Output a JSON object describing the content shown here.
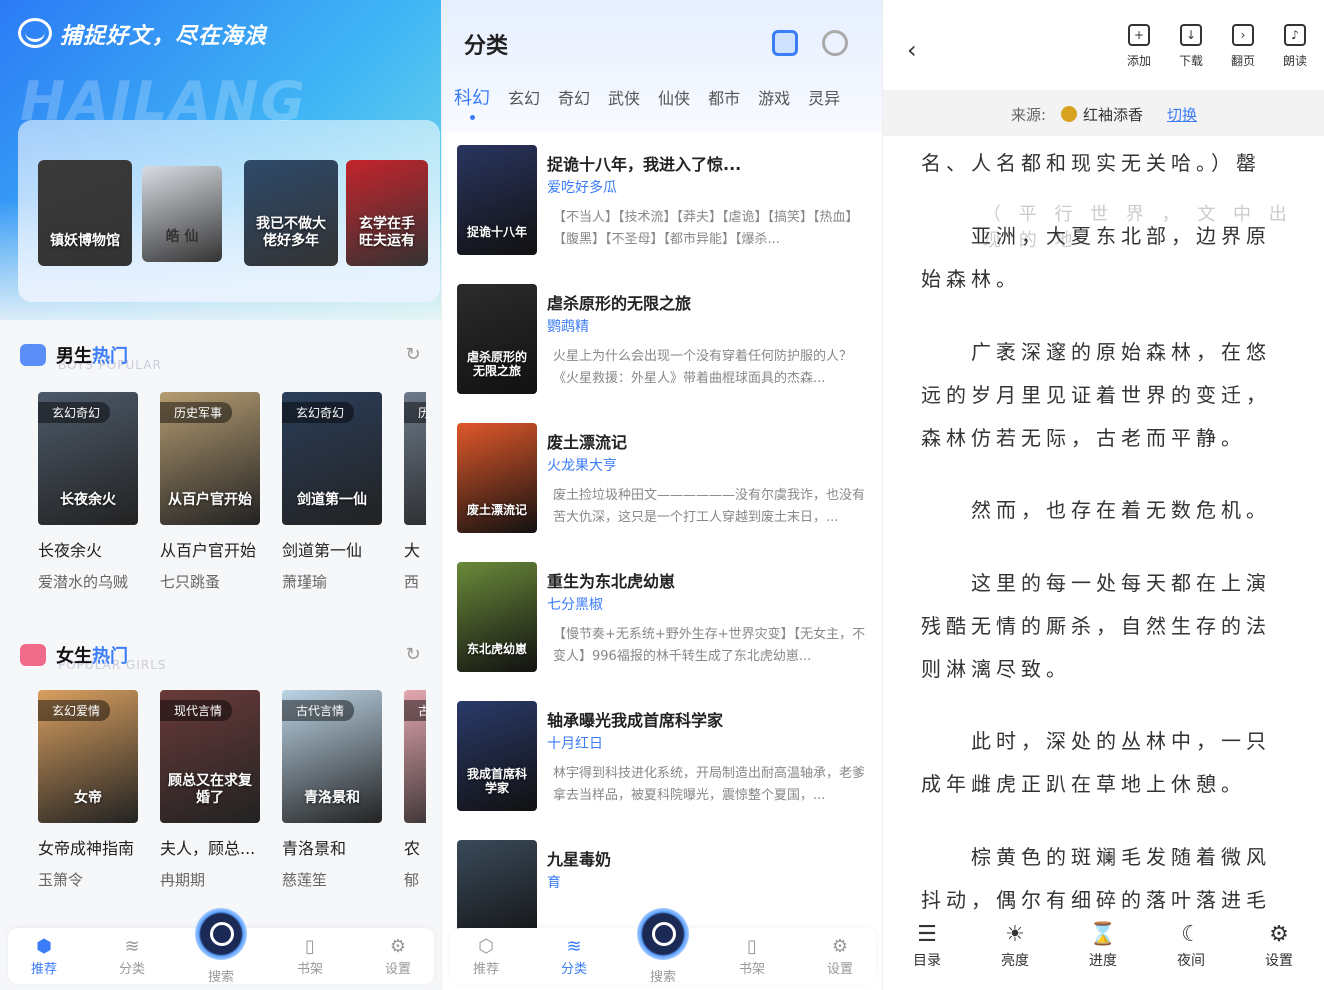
{
  "home": {
    "slogan": "捕捉好文，尽在海浪",
    "watermark": "HAILANG",
    "featured": [
      {
        "title": "镇妖博物馆",
        "bg": "#3a3a3a"
      },
      {
        "title": "皓 仙",
        "bg": "#d9dde3"
      },
      {
        "title": "我已不做大佬好多年",
        "bg": "#2e4a6b"
      },
      {
        "title": "玄学在手 旺夫运有",
        "bg": "#c4242c"
      }
    ],
    "boys_section": {
      "title_main": "男生",
      "title_hl": "热门",
      "subtitle": "BOYS POPULAR"
    },
    "boys_books": [
      {
        "tag": "玄幻奇幻",
        "name": "长夜余火",
        "author": "爱潜水的乌贼",
        "cover_title": "长夜余火",
        "bg": "#4d5a6a"
      },
      {
        "tag": "历史军事",
        "name": "从百户官开始",
        "author": "七只跳蚤",
        "cover_title": "从百户官开始",
        "bg": "#b59c72"
      },
      {
        "tag": "玄幻奇幻",
        "name": "剑道第一仙",
        "author": "萧瑾瑜",
        "cover_title": "剑道第一仙",
        "bg": "#2b3e5a"
      },
      {
        "tag": "历",
        "name": "大",
        "author": "西",
        "cover_title": "",
        "bg": "#6d7a8a"
      }
    ],
    "girls_section": {
      "title_main": "女生",
      "title_hl": "热门",
      "subtitle": "POPULAR GIRLS"
    },
    "girls_books": [
      {
        "tag": "玄幻爱情",
        "name": "女帝成神指南",
        "author": "玉箫令",
        "cover_title": "女帝",
        "bg": "#d9a060"
      },
      {
        "tag": "现代言情",
        "name": "夫人，顾总...",
        "author": "冉期期",
        "cover_title": "顾总又在求复婚了",
        "bg": "#6a3a3a"
      },
      {
        "tag": "古代言情",
        "name": "青洛景和",
        "author": "慈莲笙",
        "cover_title": "青洛景和",
        "bg": "#bcd4e6"
      },
      {
        "tag": "古",
        "name": "农",
        "author": "郁",
        "cover_title": "",
        "bg": "#e5a8b0"
      }
    ],
    "tabs": [
      {
        "label": "推荐",
        "icon": "⬢",
        "name": "home-icon"
      },
      {
        "label": "分类",
        "icon": "≋",
        "name": "layers-icon"
      },
      {
        "label": "搜索",
        "icon": "",
        "name": "search-icon"
      },
      {
        "label": "书架",
        "icon": "▯",
        "name": "bookshelf-icon"
      },
      {
        "label": "设置",
        "icon": "⚙",
        "name": "settings-icon"
      }
    ]
  },
  "category": {
    "title": "分类",
    "tabs": [
      "科幻",
      "玄幻",
      "奇幻",
      "武侠",
      "仙侠",
      "都市",
      "游戏",
      "灵异"
    ],
    "items": [
      {
        "title": "捉诡十八年，我进入了惊...",
        "author": "爱吃好多瓜",
        "desc": "【不当人】【技术流】【莽夫】【虐诡】【搞笑】【热血】【腹黑】【不圣母】【都市异能】【爆杀...",
        "bg": "#2a3560",
        "cover_title": "捉诡十八年"
      },
      {
        "title": "虐杀原形的无限之旅",
        "author": "鹦鹉精",
        "desc": "火星上为什么会出现一个没有穿着任何防护服的人？《火星救援：外星人》带着曲棍球面具的杰森...",
        "bg": "#2c2c2c",
        "cover_title": "虐杀原形的无限之旅"
      },
      {
        "title": "废土漂流记",
        "author": "火龙果大亨",
        "desc": "废土捡垃圾种田文——————没有尔虞我诈，也没有苦大仇深，这只是一个打工人穿越到废土末日，...",
        "bg": "#e0582a",
        "cover_title": "废土漂流记"
      },
      {
        "title": "重生为东北虎幼崽",
        "author": "七分黑椒",
        "desc": "【慢节奏+无系统+野外生存+世界灾变】【无女主，不变人】996福报的林千转生成了东北虎幼崽...",
        "bg": "#6a8a3a",
        "cover_title": "东北虎幼崽"
      },
      {
        "title": "轴承曝光我成首席科学家",
        "author": "十月红日",
        "desc": "林宇得到科技进化系统，开局制造出耐高温轴承，老爹拿去当样品，被夏科院曝光，震惊整个夏国，...",
        "bg": "#2a3a6a",
        "cover_title": "我成首席科学家"
      },
      {
        "title": "九星毒奶",
        "author": "育",
        "desc": "",
        "bg": "#3a4a5a",
        "cover_title": ""
      }
    ],
    "tabs_bottom": [
      {
        "label": "推荐",
        "icon": "⬡",
        "name": "home-icon"
      },
      {
        "label": "分类",
        "icon": "≋",
        "name": "layers-icon"
      },
      {
        "label": "搜索",
        "icon": "",
        "name": "search-icon"
      },
      {
        "label": "书架",
        "icon": "▯",
        "name": "bookshelf-icon"
      },
      {
        "label": "设置",
        "icon": "⚙",
        "name": "settings-icon"
      }
    ]
  },
  "reader": {
    "tools": [
      {
        "label": "添加",
        "icon": "+",
        "name": "add-shelf-icon"
      },
      {
        "label": "下载",
        "icon": "↓",
        "name": "download-icon"
      },
      {
        "label": "翻页",
        "icon": "›",
        "name": "page-turn-icon"
      },
      {
        "label": "朗读",
        "icon": "♪",
        "name": "read-aloud-icon"
      }
    ],
    "source_label": "来源:",
    "source_name": "红袖添香",
    "switch_label": "切换",
    "ghost_text": "（ 平 行 世 界 ， 文 中 出 现 的 地",
    "paragraphs": [
      "名、人名都和现实无关哈。）罄",
      "　　亚洲，大夏东北部，边界原始森林。",
      "　　广袤深邃的原始森林，在悠远的岁月里见证着世界的变迁，森林仿若无际，古老而平静。",
      "　　然而，也存在着无数危机。",
      "　　这里的每一处每天都在上演残酷无情的厮杀，自然生存的法则淋漓尽致。",
      "　　此时，深处的丛林中，一只成年雌虎正趴在草地上休憩。",
      "　　棕黄色的斑斓毛发随着微风抖动，偶尔有细碎的落叶落进毛发。"
    ],
    "bottom": [
      {
        "label": "目录",
        "icon": "☰",
        "name": "catalog-icon"
      },
      {
        "label": "亮度",
        "icon": "☀",
        "name": "brightness-icon"
      },
      {
        "label": "进度",
        "icon": "⌛",
        "name": "progress-icon"
      },
      {
        "label": "夜间",
        "icon": "☾",
        "name": "night-mode-icon"
      },
      {
        "label": "设置",
        "icon": "⚙",
        "name": "settings-icon"
      }
    ]
  }
}
